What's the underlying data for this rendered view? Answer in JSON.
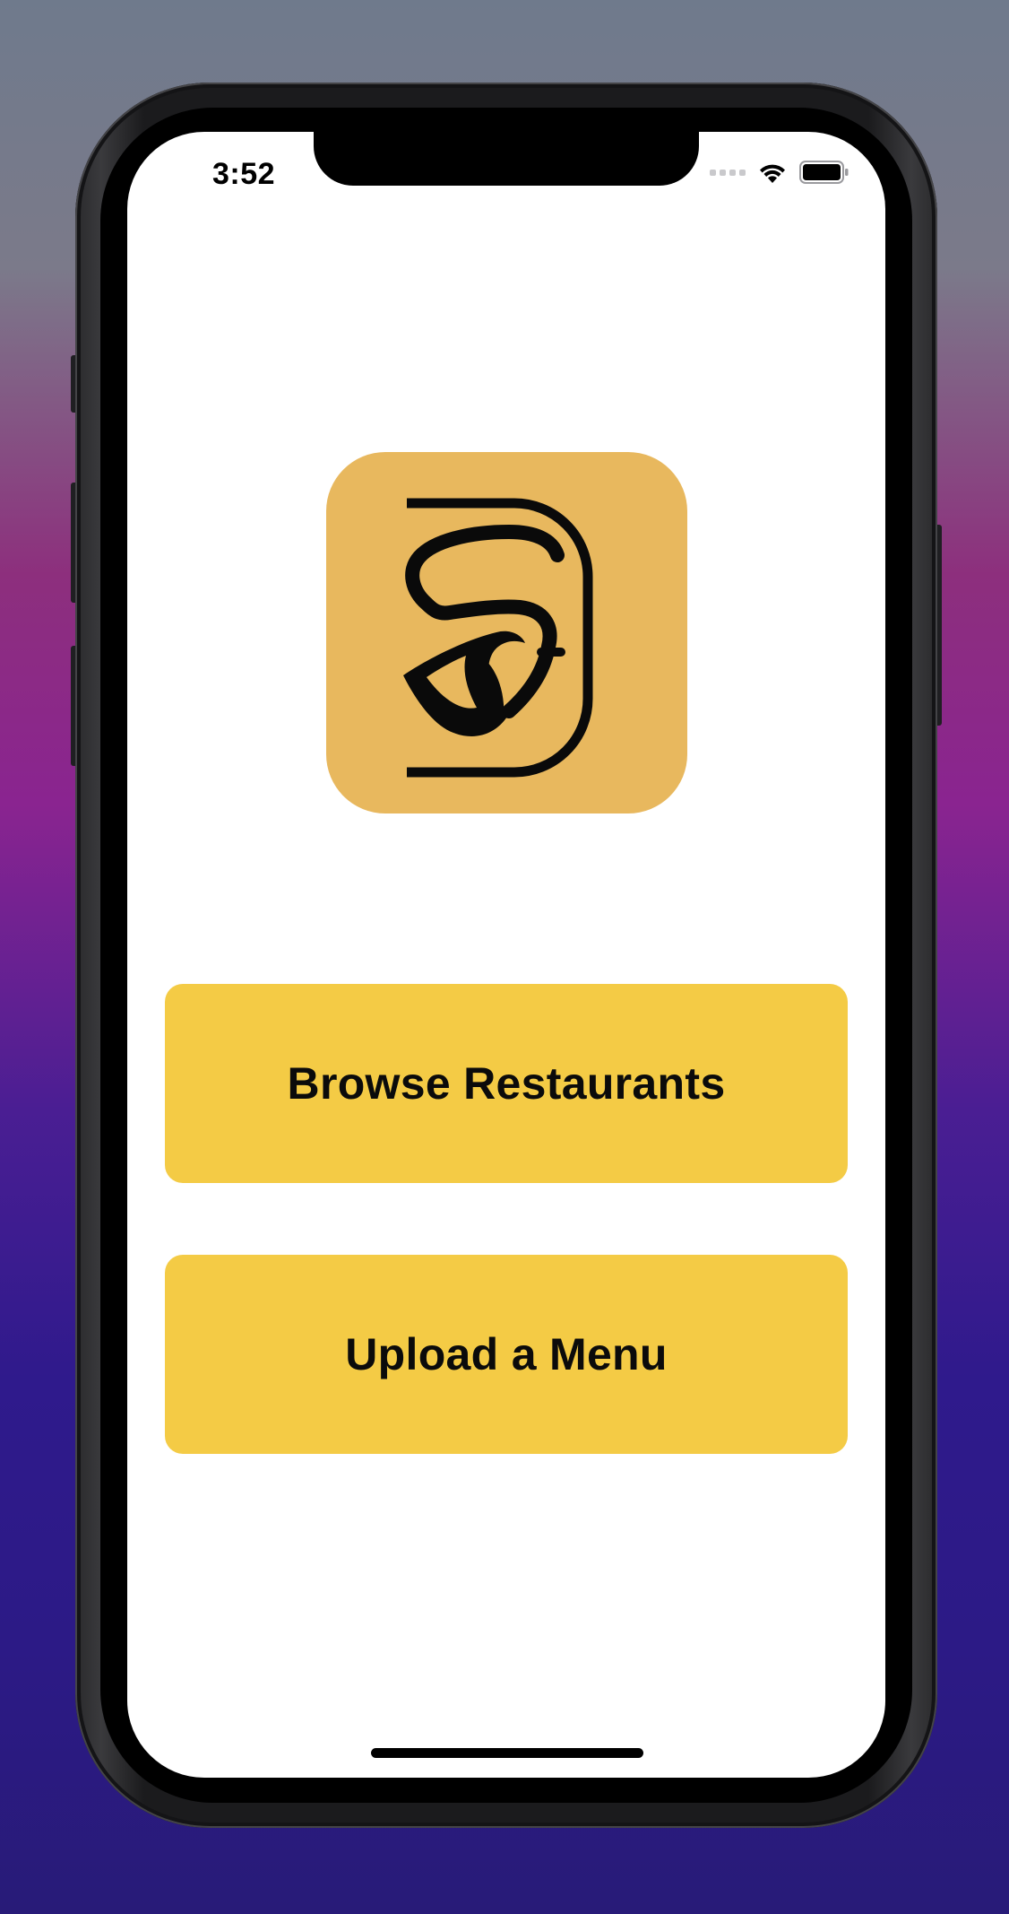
{
  "status_bar": {
    "time": "3:52",
    "icons": [
      "cellular-signal-icon",
      "wifi-icon",
      "battery-icon"
    ]
  },
  "app": {
    "logo": "app-logo-eye-icon",
    "logo_color": "#e8b85e"
  },
  "actions": {
    "browse_label": "Browse Restaurants",
    "upload_label": "Upload a Menu",
    "button_color": "#f4cb45"
  }
}
